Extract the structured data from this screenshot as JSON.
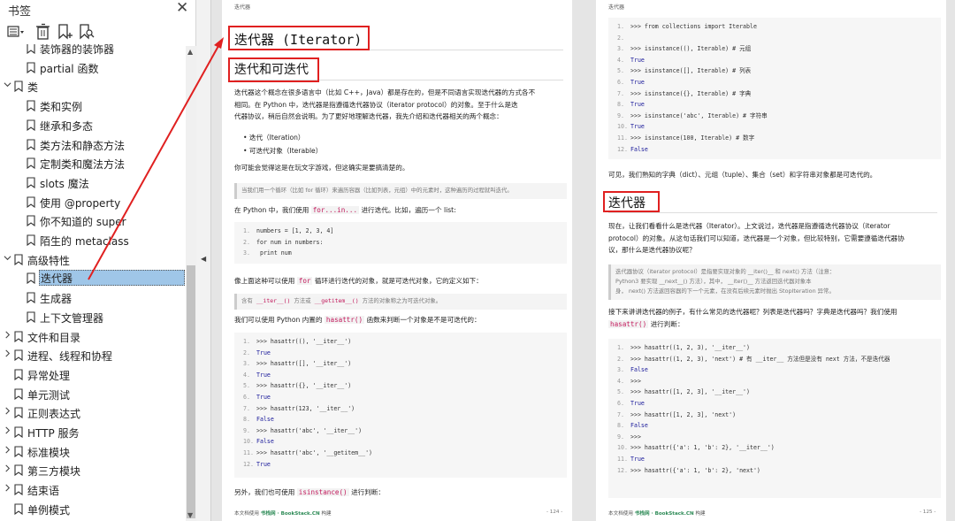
{
  "sidebar": {
    "title": "书签",
    "items": [
      {
        "label": "装饰器的装饰器",
        "indent": 1,
        "expander": ""
      },
      {
        "label": "partial 函数",
        "indent": 1,
        "expander": ""
      },
      {
        "label": "类",
        "indent": 0,
        "expander": "open"
      },
      {
        "label": "类和实例",
        "indent": 1,
        "expander": ""
      },
      {
        "label": "继承和多态",
        "indent": 1,
        "expander": ""
      },
      {
        "label": "类方法和静态方法",
        "indent": 1,
        "expander": ""
      },
      {
        "label": "定制类和魔法方法",
        "indent": 1,
        "expander": ""
      },
      {
        "label": "slots 魔法",
        "indent": 1,
        "expander": ""
      },
      {
        "label": "使用 @property",
        "indent": 1,
        "expander": ""
      },
      {
        "label": "你不知道的 super",
        "indent": 1,
        "expander": ""
      },
      {
        "label": "陌生的 metaclass",
        "indent": 1,
        "expander": ""
      },
      {
        "label": "高级特性",
        "indent": 0,
        "expander": "open"
      },
      {
        "label": "迭代器",
        "indent": 1,
        "expander": "",
        "selected": true
      },
      {
        "label": "生成器",
        "indent": 1,
        "expander": ""
      },
      {
        "label": "上下文管理器",
        "indent": 1,
        "expander": ""
      },
      {
        "label": "文件和目录",
        "indent": 0,
        "expander": "closed"
      },
      {
        "label": "进程、线程和协程",
        "indent": 0,
        "expander": "closed"
      },
      {
        "label": "异常处理",
        "indent": 0,
        "expander": ""
      },
      {
        "label": "单元测试",
        "indent": 0,
        "expander": ""
      },
      {
        "label": "正则表达式",
        "indent": 0,
        "expander": "closed"
      },
      {
        "label": "HTTP 服务",
        "indent": 0,
        "expander": "closed"
      },
      {
        "label": "标准模块",
        "indent": 0,
        "expander": "closed"
      },
      {
        "label": "第三方模块",
        "indent": 0,
        "expander": "closed"
      },
      {
        "label": "结束语",
        "indent": 0,
        "expander": "closed"
      },
      {
        "label": "单例模式",
        "indent": 0,
        "expander": ""
      }
    ]
  },
  "page1": {
    "header": "迭代器",
    "h1": "迭代器 (Iterator)",
    "h2": "迭代和可迭代",
    "intro": [
      "迭代器这个概念在很多语言中（比如 C++，Java）都是存在的，但是不同语言实现迭代器的方式各不",
      "相同。在 Python 中，迭代器是指遵循迭代器协议（iterator protocol）的对象。至于什么是迭",
      "代器协议，稍后自然会说明。为了更好地理解迭代器，我先介绍和迭代器相关的两个概念："
    ],
    "bullets": [
      "迭代（Iteration）",
      "可迭代对象（Iterable）"
    ],
    "p2": "你可能会觉得这是在玩文字游戏，但这确实是要搞清楚的。",
    "note1": "当我们用一个循环（比如 for 循环）来遍历容器（比如列表，元组）中的元素时，这种遍历的过程就叫迭代。",
    "p3a": "在 Python 中，我们使用",
    "p3code": "for...in...",
    "p3b": "进行迭代。比如，遍历一个 list:",
    "code1": [
      "numbers = [1, 2, 3, 4]",
      "for num in numbers:",
      "    print num"
    ],
    "p4a": "像上面这种可以使用",
    "p4code": "for",
    "p4b": "循环进行迭代的对象，就是可迭代对象，它的定义如下：",
    "note2a": "含有",
    "note2code1": "__iter__()",
    "note2b": "方法或",
    "note2code2": "__getitem__()",
    "note2c": "方法的对象称之为可迭代对象。",
    "p5a": "我们可以使用 Python 内置的",
    "p5code": "hasattr()",
    "p5b": "函数来判断一个对象是不是可迭代的：",
    "code2": [
      ">>> hasattr((), '__iter__')",
      "True",
      ">>> hasattr([], '__iter__')",
      "True",
      ">>> hasattr({}, '__iter__')",
      "True",
      ">>> hasattr(123, '__iter__')",
      "False",
      ">>> hasattr('abc', '__iter__')",
      "False",
      ">>> hasattr('abc', '__getitem__')",
      "True"
    ],
    "p6a": "另外，我们也可使用",
    "p6code": "isinstance()",
    "p6b": "进行判断：",
    "footer_prefix": "本文档使用",
    "footer_site": "书栈网 · BookStack.CN",
    "footer_suffix": "构建",
    "page_number": "- 124 -"
  },
  "page2": {
    "header": "迭代器",
    "code1": [
      ">>> from collections import Iterable",
      "",
      ">>> isinstance((), Iterable)        # 元组",
      "True",
      ">>> isinstance([], Iterable)        # 列表",
      "True",
      ">>> isinstance({}, Iterable)        # 字典",
      "True",
      ">>> isinstance('abc', Iterable)     # 字符串",
      "True",
      ">>> isinstance(100, Iterable)       # 数字",
      "False"
    ],
    "p1": "可见，我们熟知的字典（dict）、元组（tuple）、集合（set）和字符串对象都是可迭代的。",
    "h2": "迭代器",
    "p2": [
      "现在，让我们看看什么是迭代器（Iterator）。上文说过，迭代器是指遵循迭代器协议（iterator",
      "protocol）的对象。从这句话我们可以知道，迭代器是一个对象，但比较特别，它需要遵循迭代器协",
      "议，那什么是迭代器协议呢？"
    ],
    "note": [
      "迭代器协议（iterator protocol）是指要实现对象的  __iter()__  和  next()  方法（注意：",
      "Python3 要实现  __next__()  方法），其中，  __iter()__  方法返回迭代器对象本",
      "身，  next()  方法返回容器的下一个元素，在没有后续元素时抛出  StopIteration  异常。"
    ],
    "p3": "接下来讲讲迭代器的例子，有什么常见的迭代器呢？列表是迭代器吗？字典是迭代器吗？我们使用",
    "p3code": "hasattr()",
    "p3b": "进行判断：",
    "code2": [
      ">>> hasattr((1, 2, 3), '__iter__')",
      ">>> hasattr((1, 2, 3), 'next')  # 有 __iter__ 方法但是没有 next 方法，不是迭代器",
      "False",
      ">>>",
      ">>> hasattr([1, 2, 3], '__iter__')",
      "True",
      ">>> hasattr([1, 2, 3], 'next')",
      "False",
      ">>>",
      ">>> hasattr({'a': 1, 'b': 2}, '__iter__')",
      "True",
      ">>> hasattr({'a': 1, 'b': 2}, 'next')"
    ],
    "footer_prefix": "本文档使用",
    "footer_site": "书栈网 · BookStack.CN",
    "footer_suffix": "构建",
    "page_number": "- 125 -"
  },
  "colors": {
    "highlight_box": "#e02020",
    "selection": "#9fc6e8",
    "inline_code": "#c2185b"
  }
}
